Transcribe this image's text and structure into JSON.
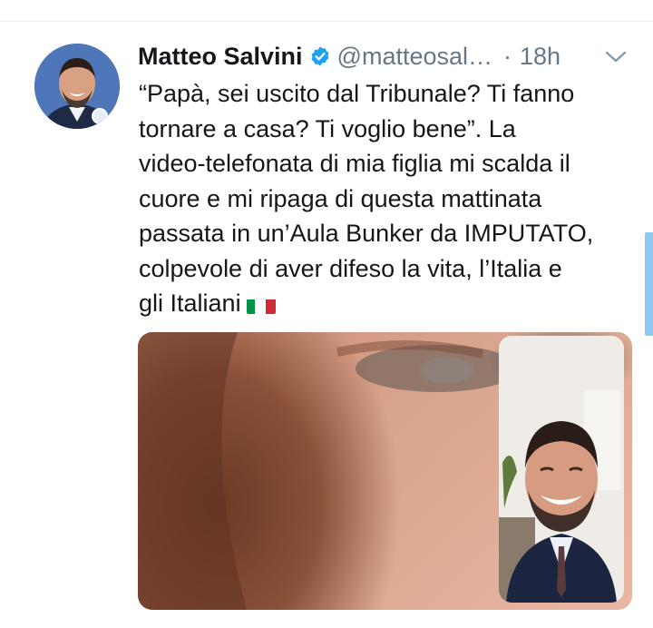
{
  "tweet": {
    "author_name": "Matteo Salvini",
    "handle": "@matteosal…",
    "separator": "·",
    "time": "18h",
    "text": "“Papà, sei uscito dal Tribunale? Ti fanno\ntornare a casa? Ti voglio bene”. La\nvideo-telefonata di mia figlia mi scalda il\ncuore e mi ripaga di questa mattinata\npassata in un’Aula Bunker da IMPUTATO,\ncolpevole di aver difeso la vita, l’Italia e\ngli Italiani",
    "emoji": "italy-flag",
    "media": {
      "description_icon": "video-call-photo"
    }
  },
  "colors": {
    "verified_blue": "#1da1f2",
    "muted_gray": "#657786",
    "flag_green": "#009246",
    "flag_white": "#ffffff",
    "flag_red": "#ce2b37"
  }
}
